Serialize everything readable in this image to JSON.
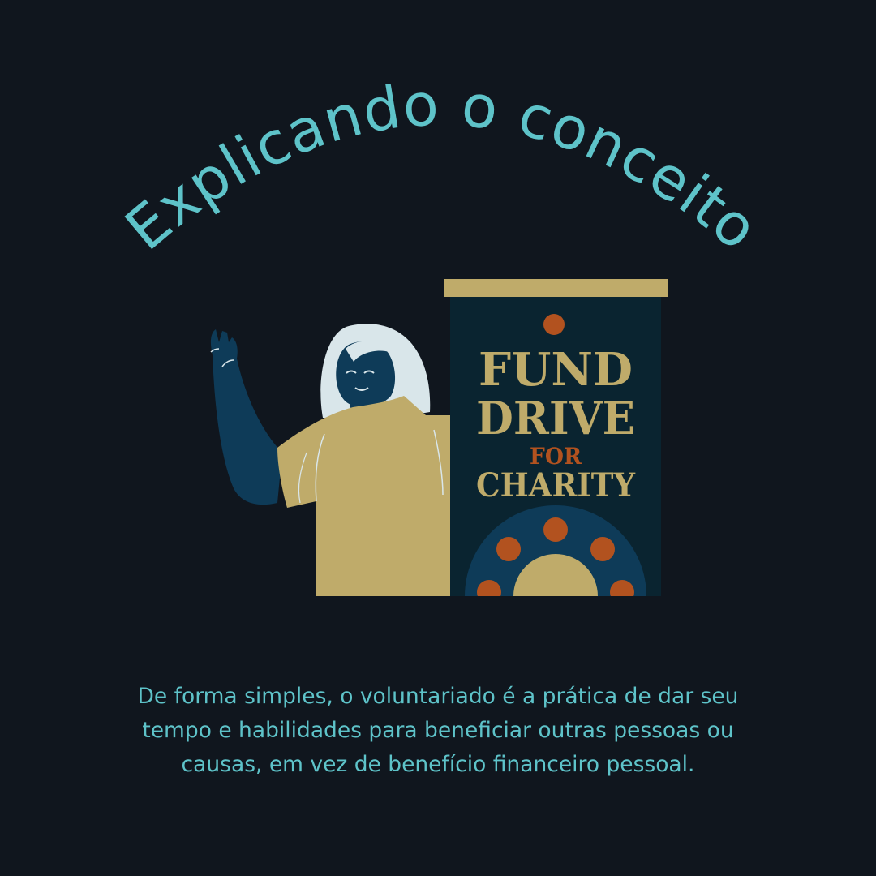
{
  "title": "Explicando o conceito",
  "banner": {
    "line1": "FUND",
    "line2": "DRIVE",
    "line3": "FOR",
    "line4": "CHARITY"
  },
  "body": {
    "line1": "De forma simples, o voluntariado é a prática de dar seu",
    "line2": "tempo e habilidades para beneficiar outras pessoas ou",
    "line3": "causas, em vez de benefício financeiro pessoal."
  },
  "colors": {
    "background": "#10161e",
    "accent": "#5ec3c9",
    "gold": "#bfab6a",
    "navy": "#0e3b58",
    "rust": "#b2521f",
    "banner_bg": "#0a2430",
    "hair": "#d9e6ea"
  }
}
